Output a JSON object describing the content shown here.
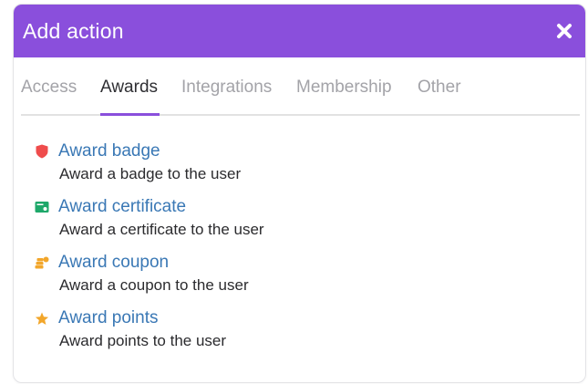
{
  "dialog": {
    "title": "Add action",
    "colors": {
      "header": "#8a4fdc",
      "link": "#3a78b5"
    }
  },
  "tabs": [
    {
      "label": "Access",
      "active": false
    },
    {
      "label": "Awards",
      "active": true
    },
    {
      "label": "Integrations",
      "active": false
    },
    {
      "label": "Membership",
      "active": false
    },
    {
      "label": "Other",
      "active": false
    }
  ],
  "actions": [
    {
      "title": "Award badge",
      "description": "Award a badge to the user",
      "icon": "shield-icon",
      "icon_color": "#ef4c4c"
    },
    {
      "title": "Award certificate",
      "description": "Award a certificate to the user",
      "icon": "certificate-icon",
      "icon_color": "#1ea86a"
    },
    {
      "title": "Award coupon",
      "description": "Award a coupon to the user",
      "icon": "coins-icon",
      "icon_color": "#f2a62a"
    },
    {
      "title": "Award points",
      "description": "Award points to the user",
      "icon": "star-icon",
      "icon_color": "#f2a62a"
    }
  ]
}
